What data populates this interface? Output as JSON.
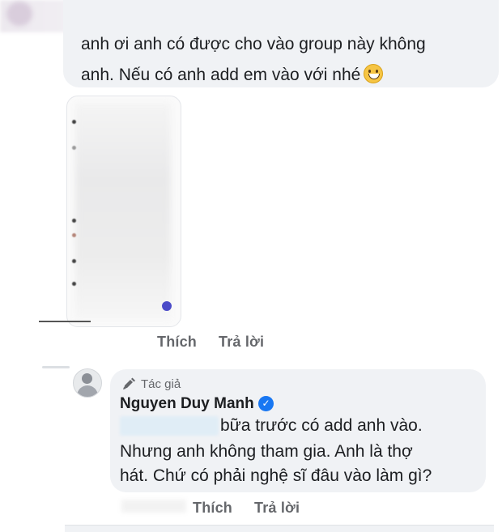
{
  "comment": {
    "line1": "anh ơi anh có được cho vào group này không",
    "line2": "anh. Nếu có anh add em vào với nhé",
    "emoji_icon": "grinning-face-icon"
  },
  "comment_actions": {
    "like": "Thích",
    "reply": "Trả lời"
  },
  "reply": {
    "author_badge": "Tác giả",
    "author_name": "Nguyen Duy Manh",
    "line1": "bữa trước có add anh vào.",
    "line2": "Nhưng anh không tham gia. Anh là thợ",
    "line3": "hát. Chứ có phải nghệ sĩ đâu vào làm gì?"
  },
  "reply_actions": {
    "like": "Thích",
    "reply": "Trả lời"
  },
  "colors": {
    "bubble": "#f0f2f5",
    "secondary_text": "#65676b",
    "verified": "#1877f2"
  }
}
